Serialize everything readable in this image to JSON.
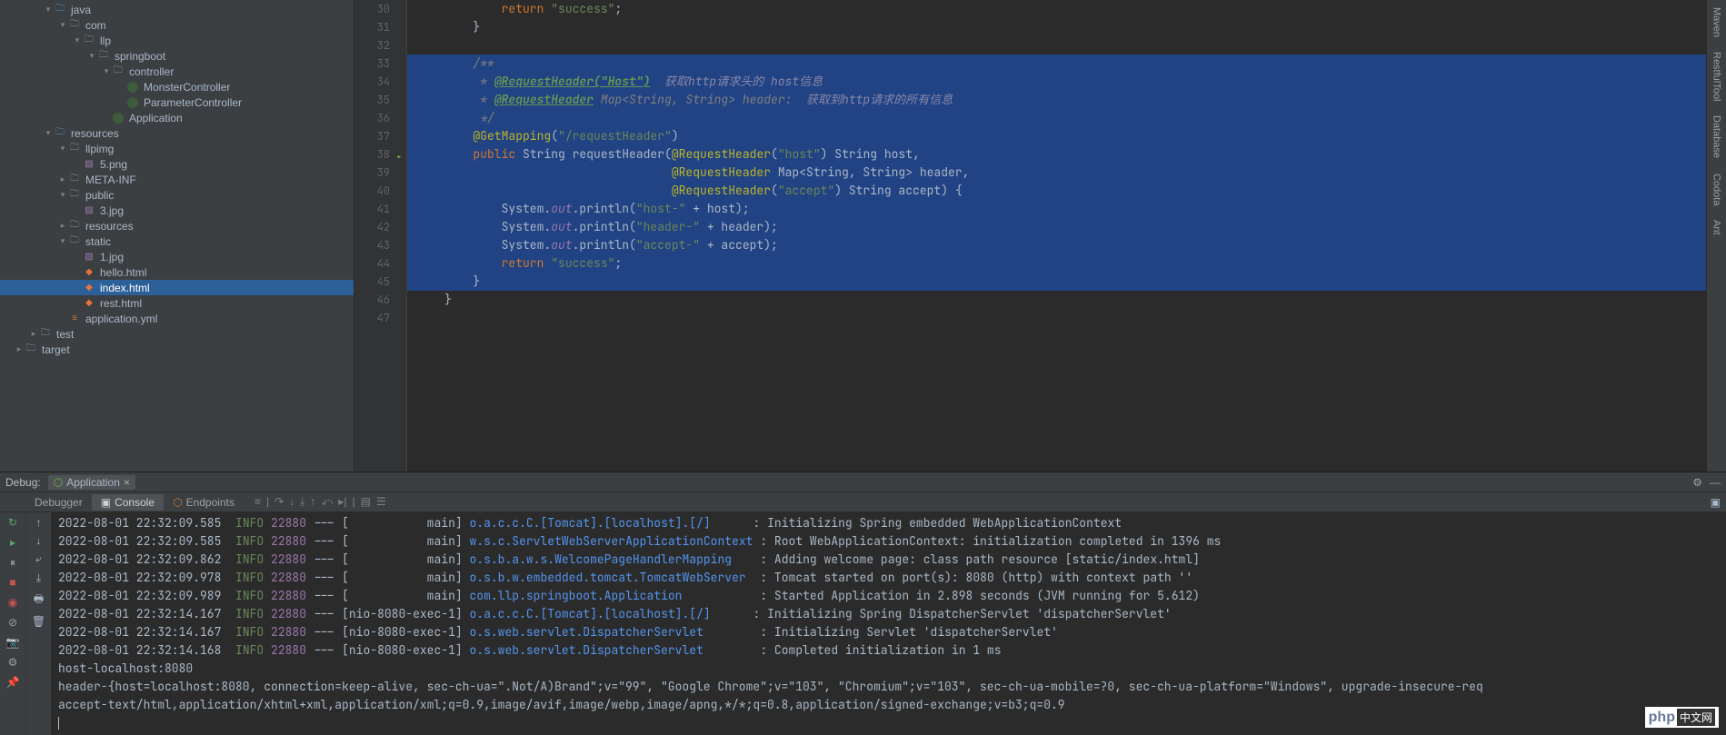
{
  "tree": [
    {
      "depth": 3,
      "arrow": "open",
      "icon": "folder-src",
      "label": "java"
    },
    {
      "depth": 4,
      "arrow": "open",
      "icon": "folder",
      "label": "com"
    },
    {
      "depth": 5,
      "arrow": "open",
      "icon": "folder",
      "label": "llp"
    },
    {
      "depth": 6,
      "arrow": "open",
      "icon": "folder",
      "label": "springboot"
    },
    {
      "depth": 7,
      "arrow": "open",
      "icon": "folder",
      "label": "controller"
    },
    {
      "depth": 8,
      "arrow": "",
      "icon": "class",
      "label": "MonsterController"
    },
    {
      "depth": 8,
      "arrow": "",
      "icon": "class",
      "label": "ParameterController"
    },
    {
      "depth": 7,
      "arrow": "",
      "icon": "class",
      "label": "Application"
    },
    {
      "depth": 3,
      "arrow": "open",
      "icon": "folder-src",
      "label": "resources"
    },
    {
      "depth": 4,
      "arrow": "open",
      "icon": "folder",
      "label": "llpimg"
    },
    {
      "depth": 5,
      "arrow": "",
      "icon": "img",
      "label": "5.png"
    },
    {
      "depth": 4,
      "arrow": "closed",
      "icon": "folder",
      "label": "META-INF"
    },
    {
      "depth": 4,
      "arrow": "open",
      "icon": "folder",
      "label": "public"
    },
    {
      "depth": 5,
      "arrow": "",
      "icon": "img",
      "label": "3.jpg"
    },
    {
      "depth": 4,
      "arrow": "closed",
      "icon": "folder",
      "label": "resources"
    },
    {
      "depth": 4,
      "arrow": "open",
      "icon": "folder",
      "label": "static"
    },
    {
      "depth": 5,
      "arrow": "",
      "icon": "img",
      "label": "1.jpg"
    },
    {
      "depth": 5,
      "arrow": "",
      "icon": "html",
      "label": "hello.html"
    },
    {
      "depth": 5,
      "arrow": "",
      "icon": "html",
      "label": "index.html",
      "selected": true
    },
    {
      "depth": 5,
      "arrow": "",
      "icon": "html",
      "label": "rest.html"
    },
    {
      "depth": 4,
      "arrow": "",
      "icon": "yml",
      "label": "application.yml"
    },
    {
      "depth": 2,
      "arrow": "closed",
      "icon": "folder",
      "label": "test"
    },
    {
      "depth": 1,
      "arrow": "closed",
      "icon": "folder",
      "label": "target"
    }
  ],
  "editor": {
    "startLine": 30,
    "lines": [
      {
        "n": 30,
        "html": "            <span class='kw'>return</span> <span class='str'>\"success\"</span>;"
      },
      {
        "n": 31,
        "html": "        }"
      },
      {
        "n": 32,
        "html": ""
      },
      {
        "n": 33,
        "hl": true,
        "bulb": true,
        "html": "        <span class='com'>/**</span>"
      },
      {
        "n": 34,
        "hl": true,
        "html": "        <span class='com'> * <span class='doclink'>@RequestHeader(\"Host\")</span>  <span class='cn'>获取http请求头的 host信息</span></span>"
      },
      {
        "n": 35,
        "hl": true,
        "html": "        <span class='com'> * <span class='doclink'>@RequestHeader</span> Map&lt;String, String&gt; header:  <span class='cn'>获取到http请求的所有信息</span></span>"
      },
      {
        "n": 36,
        "hl": true,
        "html": "        <span class='com'> */</span>"
      },
      {
        "n": 37,
        "hl": true,
        "html": "        <span class='anno'>@GetMapping</span>(<span class='str'>\"/requestHeader\"</span>)"
      },
      {
        "n": 38,
        "hl": true,
        "run": true,
        "html": "        <span class='kw'>public</span> String <span class='type'>requestHeader</span>(<span class='anno'>@RequestHeader</span>(<span class='str'>\"host\"</span>) String host,"
      },
      {
        "n": 39,
        "hl": true,
        "html": "                                    <span class='anno'>@RequestHeader</span> Map&lt;String, String&gt; header,"
      },
      {
        "n": 40,
        "hl": true,
        "html": "                                    <span class='anno'>@RequestHeader</span>(<span class='str'>\"accept\"</span>) String accept) {"
      },
      {
        "n": 41,
        "hl": true,
        "html": "            System.<span class='field'>out</span>.println(<span class='str'>\"host-\"</span> + host);"
      },
      {
        "n": 42,
        "hl": true,
        "html": "            System.<span class='field'>out</span>.println(<span class='str'>\"header-\"</span> + header);"
      },
      {
        "n": 43,
        "hl": true,
        "html": "            System.<span class='field'>out</span>.println(<span class='str'>\"accept-\"</span> + accept);"
      },
      {
        "n": 44,
        "hl": true,
        "html": "            <span class='kw'>return</span> <span class='str'>\"success\"</span>;"
      },
      {
        "n": 45,
        "hl": true,
        "html": "        }"
      },
      {
        "n": 46,
        "html": "    }"
      },
      {
        "n": 47,
        "html": ""
      }
    ]
  },
  "rightStripe": [
    "Maven",
    "RestfulTool",
    "Database",
    "Codota",
    "Ant"
  ],
  "debug": {
    "title": "Debug:",
    "app": "Application",
    "tabs": {
      "debugger": "Debugger",
      "console": "Console",
      "endpoints": "Endpoints"
    },
    "log": [
      {
        "ts": "2022-08-01 22:32:09.585",
        "level": "INFO",
        "pid": "22880",
        "thread": "[           main]",
        "logger": "o.a.c.c.C.[Tomcat].[localhost].[/]     ",
        "msg": ": Initializing Spring embedded WebApplicationContext"
      },
      {
        "ts": "2022-08-01 22:32:09.585",
        "level": "INFO",
        "pid": "22880",
        "thread": "[           main]",
        "logger": "w.s.c.ServletWebServerApplicationContext",
        "msg": ": Root WebApplicationContext: initialization completed in 1396 ms"
      },
      {
        "ts": "2022-08-01 22:32:09.862",
        "level": "INFO",
        "pid": "22880",
        "thread": "[           main]",
        "logger": "o.s.b.a.w.s.WelcomePageHandlerMapping   ",
        "msg": ": Adding welcome page: class path resource [static/index.html]"
      },
      {
        "ts": "2022-08-01 22:32:09.978",
        "level": "INFO",
        "pid": "22880",
        "thread": "[           main]",
        "logger": "o.s.b.w.embedded.tomcat.TomcatWebServer ",
        "msg": ": Tomcat started on port(s): 8080 (http) with context path ''"
      },
      {
        "ts": "2022-08-01 22:32:09.989",
        "level": "INFO",
        "pid": "22880",
        "thread": "[           main]",
        "logger": "com.llp.springboot.Application          ",
        "msg": ": Started Application in 2.898 seconds (JVM running for 5.612)"
      },
      {
        "ts": "2022-08-01 22:32:14.167",
        "level": "INFO",
        "pid": "22880",
        "thread": "[nio-8080-exec-1]",
        "logger": "o.a.c.c.C.[Tomcat].[localhost].[/]     ",
        "msg": ": Initializing Spring DispatcherServlet 'dispatcherServlet'"
      },
      {
        "ts": "2022-08-01 22:32:14.167",
        "level": "INFO",
        "pid": "22880",
        "thread": "[nio-8080-exec-1]",
        "logger": "o.s.web.servlet.DispatcherServlet       ",
        "msg": ": Initializing Servlet 'dispatcherServlet'"
      },
      {
        "ts": "2022-08-01 22:32:14.168",
        "level": "INFO",
        "pid": "22880",
        "thread": "[nio-8080-exec-1]",
        "logger": "o.s.web.servlet.DispatcherServlet       ",
        "msg": ": Completed initialization in 1 ms"
      }
    ],
    "stdout": [
      "host-localhost:8080",
      "header-{host=localhost:8080, connection=keep-alive, sec-ch-ua=\".Not/A)Brand\";v=\"99\", \"Google Chrome\";v=\"103\", \"Chromium\";v=\"103\", sec-ch-ua-mobile=?0, sec-ch-ua-platform=\"Windows\", upgrade-insecure-req",
      "accept-text/html,application/xhtml+xml,application/xml;q=0.9,image/avif,image/webp,image/apng,*/*;q=0.8,application/signed-exchange;v=b3;q=0.9"
    ]
  },
  "watermark": {
    "left": "php",
    "right": "中文网"
  }
}
